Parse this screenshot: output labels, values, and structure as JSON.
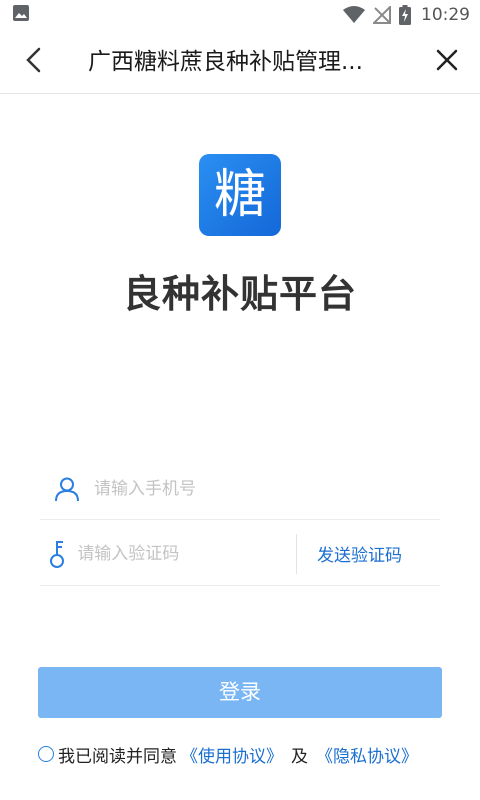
{
  "status_bar": {
    "time": "10:29",
    "icons": [
      "image-icon",
      "wifi-icon",
      "no-signal-icon",
      "battery-charging-icon"
    ]
  },
  "app_bar": {
    "title": "广西糖料蔗良种补贴管理...",
    "back_icon": "back-arrow-icon",
    "close_icon": "close-icon"
  },
  "logo": {
    "glyph": "糖",
    "color": "#1d7fe6"
  },
  "platform_title": "良种补贴平台",
  "form": {
    "phone_placeholder": "请输入手机号",
    "code_placeholder": "请输入验证码",
    "send_code_label": "发送验证码"
  },
  "login_button": "登录",
  "agreement": {
    "prefix": "我已阅读并同意",
    "terms_link": "《使用协议》",
    "and": "及",
    "privacy_link": "《隐私协议》"
  },
  "colors": {
    "accent": "#1a6fd0",
    "login_button": "#7ab6f4"
  }
}
